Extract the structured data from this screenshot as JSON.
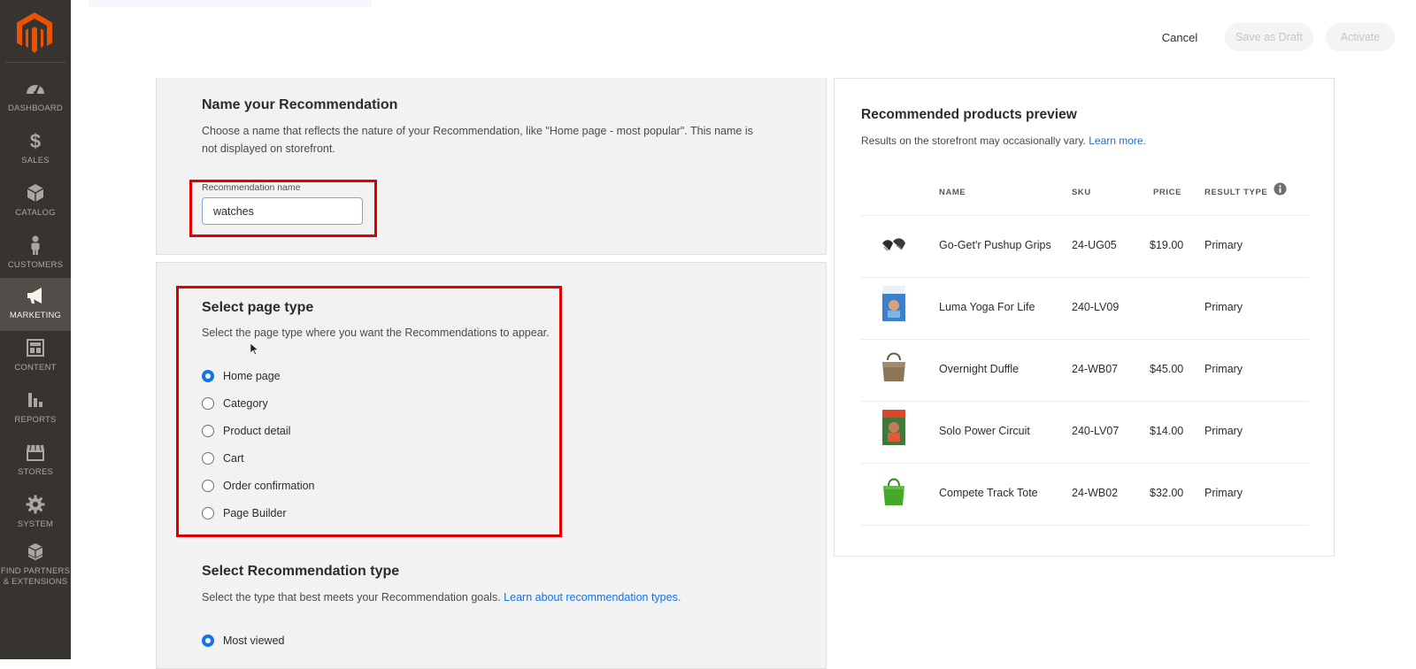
{
  "sidebar": {
    "items": [
      {
        "label": "DASHBOARD",
        "icon": "dashboard-icon"
      },
      {
        "label": "SALES",
        "icon": "dollar-icon"
      },
      {
        "label": "CATALOG",
        "icon": "cube-icon"
      },
      {
        "label": "CUSTOMERS",
        "icon": "person-icon"
      },
      {
        "label": "MARKETING",
        "icon": "megaphone-icon",
        "active": true
      },
      {
        "label": "CONTENT",
        "icon": "layout-icon"
      },
      {
        "label": "REPORTS",
        "icon": "bar-chart-icon"
      },
      {
        "label": "STORES",
        "icon": "store-icon"
      },
      {
        "label": "SYSTEM",
        "icon": "gear-icon"
      },
      {
        "label_line1": "FIND PARTNERS",
        "label_line2": "& EXTENSIONS",
        "icon": "boxes-icon"
      }
    ]
  },
  "toolbar": {
    "cancel_label": "Cancel",
    "draft_label": "Save as Draft",
    "activate_label": "Activate"
  },
  "name_section": {
    "title": "Name your Recommendation",
    "description": "Choose a name that reflects the nature of your Recommendation, like \"Home page - most popular\". This name is not displayed on storefront.",
    "field_label": "Recommendation name",
    "field_value": "watches"
  },
  "page_type_section": {
    "title": "Select page type",
    "description": "Select the page type where you want the Recommendations to appear.",
    "options": [
      {
        "label": "Home page",
        "selected": true
      },
      {
        "label": "Category",
        "selected": false
      },
      {
        "label": "Product detail",
        "selected": false
      },
      {
        "label": "Cart",
        "selected": false
      },
      {
        "label": "Order confirmation",
        "selected": false
      },
      {
        "label": "Page Builder",
        "selected": false
      }
    ]
  },
  "rec_type_section": {
    "title": "Select Recommendation type",
    "description": "Select the type that best meets your Recommendation goals.",
    "link": "Learn about recommendation types.",
    "options": [
      {
        "label": "Most viewed",
        "selected": true
      }
    ]
  },
  "preview": {
    "title": "Recommended products preview",
    "description": "Results on the storefront may occasionally vary.",
    "link": "Learn more.",
    "columns": [
      "NAME",
      "SKU",
      "PRICE",
      "RESULT TYPE"
    ],
    "rows": [
      {
        "name": "Go-Get'r Pushup Grips",
        "sku": "24-UG05",
        "price": "$19.00",
        "type": "Primary"
      },
      {
        "name": "Luma Yoga For Life",
        "sku": "240-LV09",
        "price": "",
        "type": "Primary"
      },
      {
        "name": "Overnight Duffle",
        "sku": "24-WB07",
        "price": "$45.00",
        "type": "Primary"
      },
      {
        "name": "Solo Power Circuit",
        "sku": "240-LV07",
        "price": "$14.00",
        "type": "Primary"
      },
      {
        "name": "Compete Track Tote",
        "sku": "24-WB02",
        "price": "$32.00",
        "type": "Primary"
      }
    ]
  },
  "colors": {
    "sidebar": "#373330",
    "accent": "#1473e6",
    "highlight": "#e00000",
    "logo": "#eb5202"
  }
}
